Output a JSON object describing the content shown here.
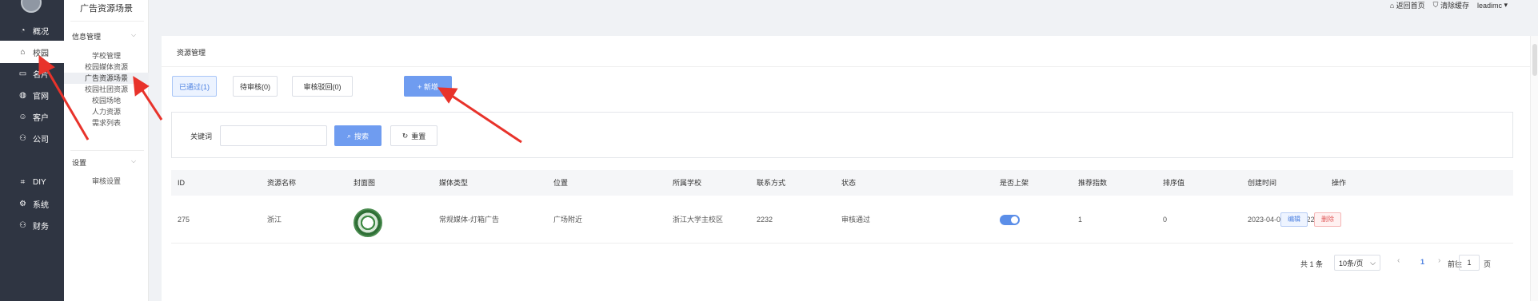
{
  "header": {
    "section_title": "广告资源场景",
    "links": [
      {
        "icon": "home-icon",
        "label": "返回首页"
      },
      {
        "icon": "trash-icon",
        "label": "清除缓存"
      },
      {
        "icon": "user-icon",
        "label": "leadimc"
      }
    ]
  },
  "sidebar": {
    "items": [
      {
        "icon": "pie-chart-icon",
        "label": "概况"
      },
      {
        "icon": "school-icon",
        "label": "校园"
      },
      {
        "icon": "card-icon",
        "label": "名片"
      },
      {
        "icon": "globe-icon",
        "label": "官网"
      },
      {
        "icon": "person-icon",
        "label": "客户"
      },
      {
        "icon": "org-icon",
        "label": "公司"
      },
      {
        "icon": "diy-icon",
        "label": "DIY"
      },
      {
        "icon": "gear-icon",
        "label": "系统"
      },
      {
        "icon": "finance-icon",
        "label": "财务"
      }
    ],
    "active_index": 1
  },
  "submenu": {
    "group1": "信息管理",
    "group1_items": [
      "学校管理",
      "校园媒体资源",
      "广告资源场景",
      "校园社团资源",
      "校园场地",
      "人力资源",
      "需求列表"
    ],
    "group2": "设置",
    "group2_items": [
      "审核设置"
    ],
    "active_label": "广告资源场景"
  },
  "main": {
    "breadcrumb": "资源管理",
    "tabs": [
      "已通过(1)",
      "待审核(0)",
      "审核驳回(0)"
    ],
    "add_label": "+ 新增",
    "filter": {
      "keyword_label": "关键词",
      "keyword_value": "",
      "search_label": "搜索",
      "reset_label": "重置"
    },
    "table": {
      "headers": [
        "ID",
        "资源名称",
        "封面图",
        "媒体类型",
        "位置",
        "所属学校",
        "联系方式",
        "状态",
        "是否上架",
        "推荐指数",
        "排序值",
        "创建时间",
        "操作"
      ],
      "rows": [
        {
          "id": "275",
          "name": "浙江",
          "media_type": "常规媒体-灯箱广告",
          "location": "广场附近",
          "school": "浙江大学主校区",
          "contact": "2232",
          "status": "审核通过",
          "listed": true,
          "recommend": "1",
          "sort": "0",
          "created": "2023-04-06 15:23:22",
          "edit_label": "编辑",
          "delete_label": "删除"
        }
      ]
    },
    "pagination": {
      "total": "共 1 条",
      "page_size": "10条/页",
      "current_page": "1",
      "jump_label": "前往",
      "jump_value": "1",
      "page_unit": "页"
    }
  },
  "colors": {
    "sidebar_bg": "#2f3542",
    "primary": "#6f9cf0",
    "annotation_red": "#e8332b"
  }
}
